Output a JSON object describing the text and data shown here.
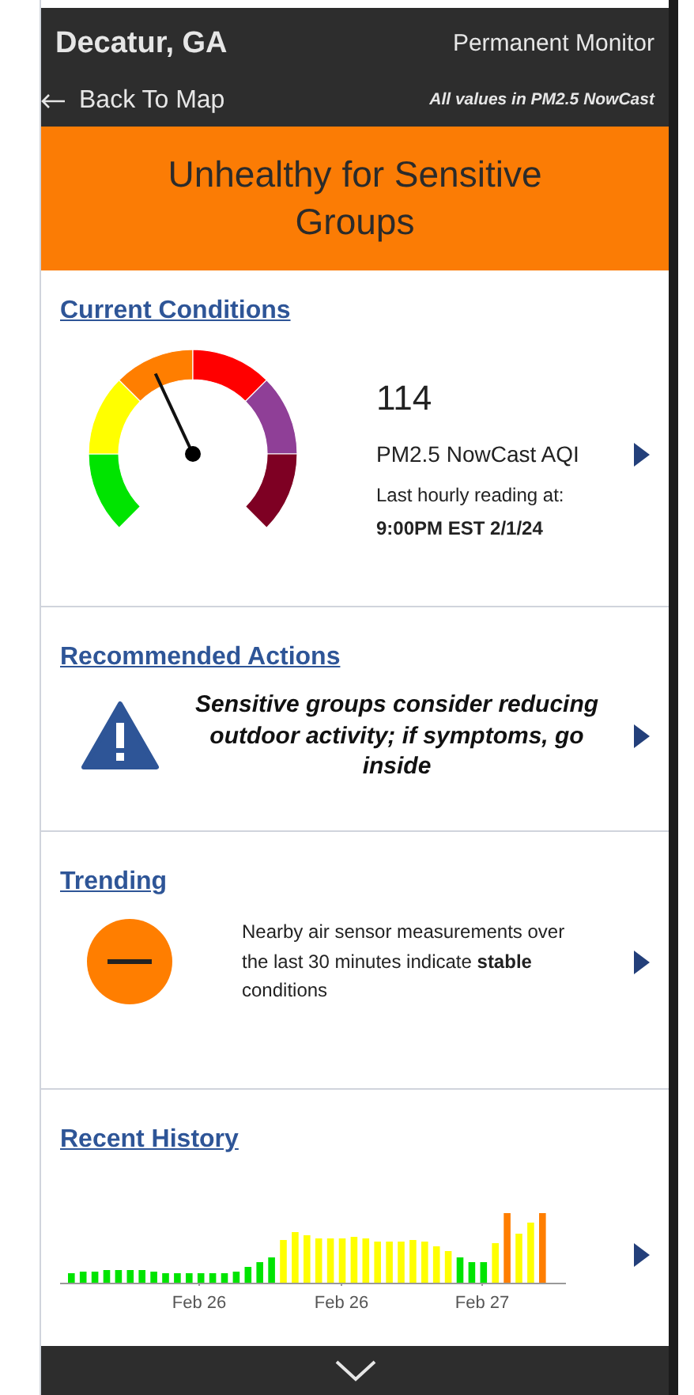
{
  "header": {
    "title": "Decatur, GA",
    "monitor_type": "Permanent Monitor",
    "back_link": "Back To Map",
    "units_note": "All values in PM2.5 NowCast"
  },
  "banner": {
    "text": "Unhealthy for Sensitive Groups",
    "color": "#fb7c05"
  },
  "current_conditions": {
    "heading": "Current Conditions",
    "value": "114",
    "metric": "PM2.5 NowCast AQI",
    "reading_label": "Last hourly reading at:",
    "reading_time": "9:00PM EST 2/1/24"
  },
  "recommended_actions": {
    "heading": "Recommended Actions",
    "message": "Sensitive groups consider reducing outdoor activity; if symptoms, go inside"
  },
  "trending": {
    "heading": "Trending",
    "message": "Nearby air sensor measurements over the last 30 minutes indicate **stable** conditions"
  },
  "recent_history": {
    "heading": "Recent History",
    "x_labels": [
      "Feb 26",
      "Feb 26",
      "Feb 27"
    ]
  }
}
